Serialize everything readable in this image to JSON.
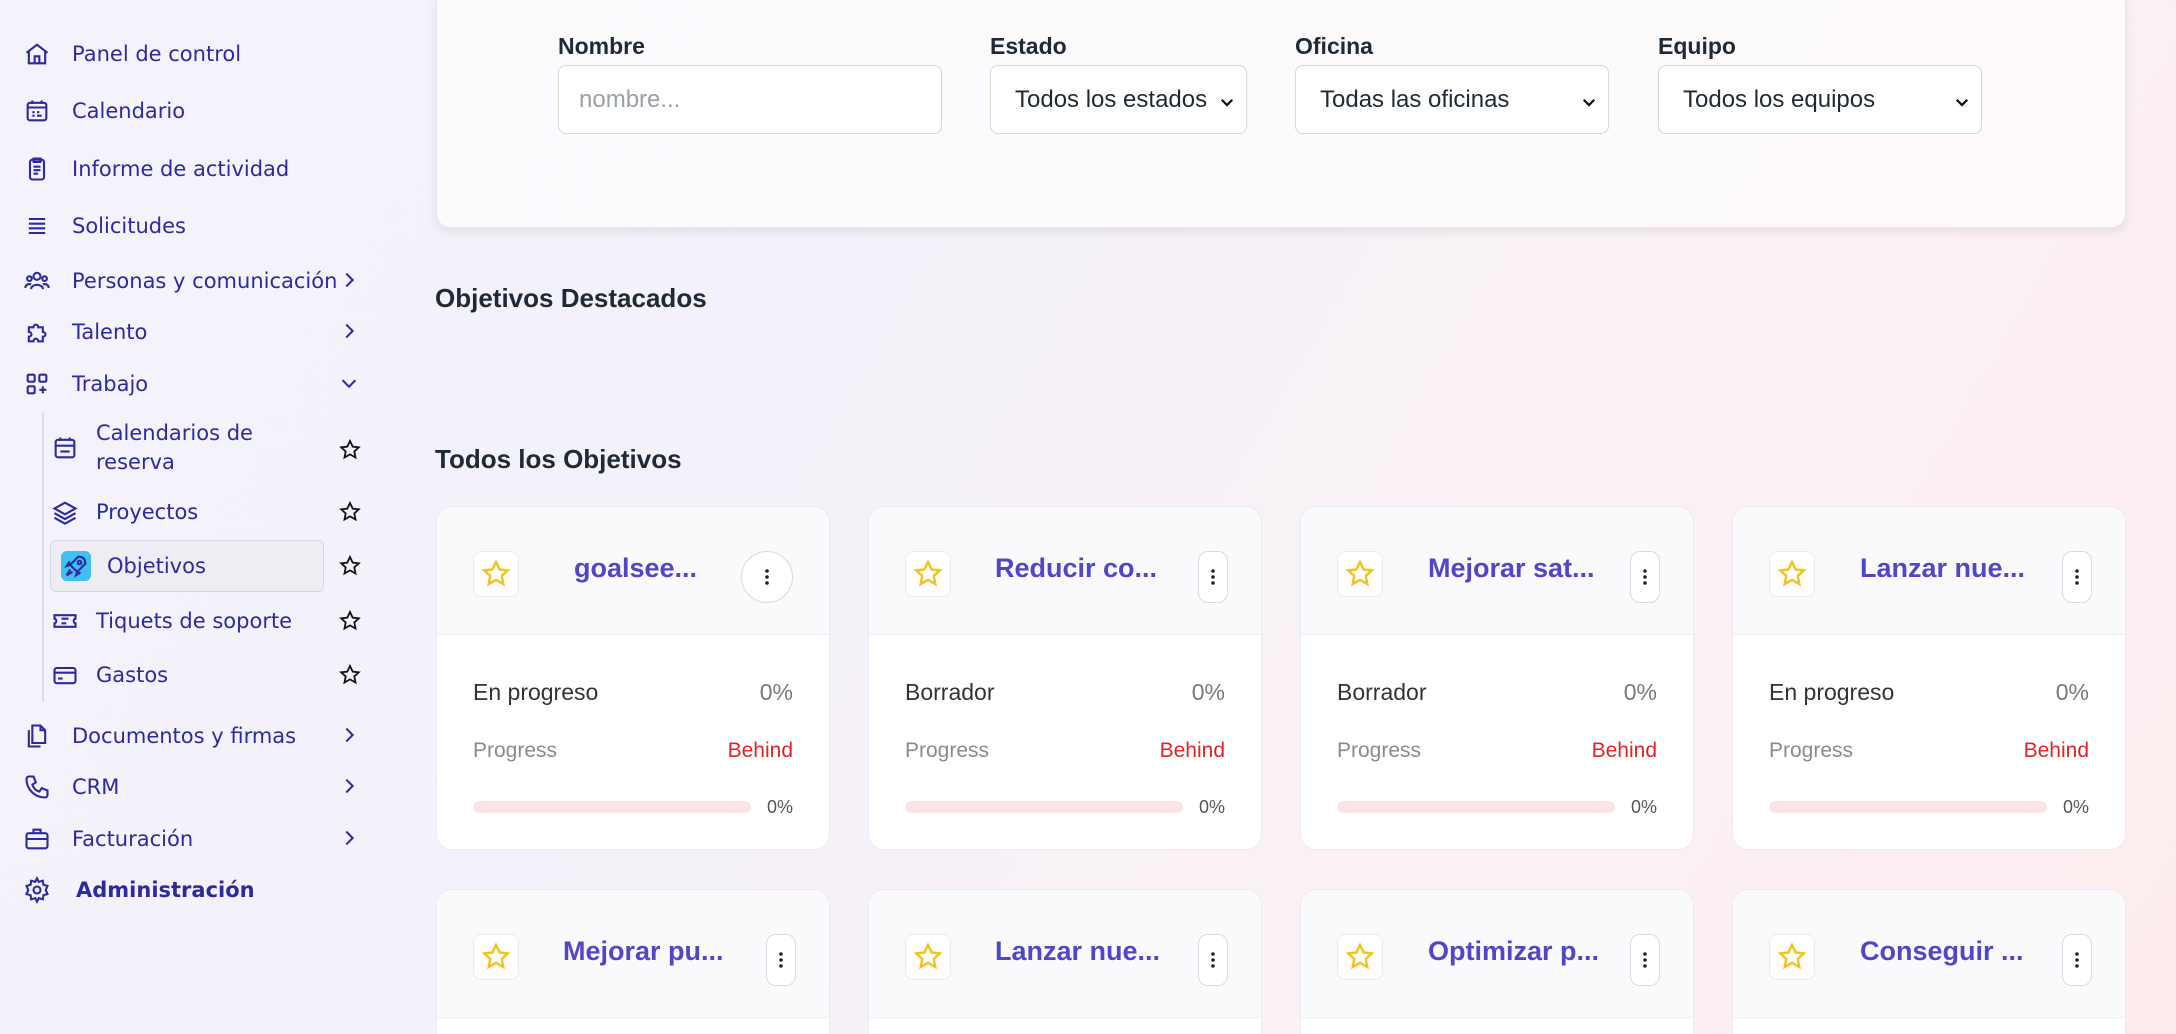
{
  "sidebar": {
    "items": [
      {
        "label": "Panel de control",
        "icon": "home-icon"
      },
      {
        "label": "Calendario",
        "icon": "calendar-icon"
      },
      {
        "label": "Informe de actividad",
        "icon": "clipboard-icon"
      },
      {
        "label": "Solicitudes",
        "icon": "list-icon"
      },
      {
        "label": "Personas y comunicación",
        "icon": "users-icon"
      },
      {
        "label": "Talento",
        "icon": "puzzle-icon"
      },
      {
        "label": "Trabajo",
        "icon": "grid-plus-icon"
      },
      {
        "label": "Documentos y firmas",
        "icon": "documents-icon"
      },
      {
        "label": "CRM",
        "icon": "phone-icon"
      },
      {
        "label": "Facturación",
        "icon": "briefcase-icon"
      },
      {
        "label": "Administración",
        "icon": "gear-icon"
      }
    ],
    "work_subitems": [
      {
        "label": "Calendarios de reserva",
        "icon": "calendar-booking-icon"
      },
      {
        "label": "Proyectos",
        "icon": "layers-icon"
      },
      {
        "label": "Objetivos",
        "icon": "rocket-icon"
      },
      {
        "label": "Tiquets de soporte",
        "icon": "ticket-icon"
      },
      {
        "label": "Gastos",
        "icon": "credit-card-icon"
      }
    ]
  },
  "filters": {
    "name_label": "Nombre",
    "name_placeholder": "nombre...",
    "status_label": "Estado",
    "status_value": "Todos los estados",
    "office_label": "Oficina",
    "office_value": "Todas las oficinas",
    "team_label": "Equipo",
    "team_value": "Todos los equipos"
  },
  "sections": {
    "featured": "Objetivos Destacados",
    "all": "Todos los Objetivos"
  },
  "cards": [
    {
      "title": "goalsee...",
      "status": "En progreso",
      "percent": "0%",
      "progress_label": "Progress",
      "progress_state": "Behind",
      "progress": 0,
      "progress_text": "0%"
    },
    {
      "title": "Reducir co...",
      "status": "Borrador",
      "percent": "0%",
      "progress_label": "Progress",
      "progress_state": "Behind",
      "progress": 0,
      "progress_text": "0%"
    },
    {
      "title": "Mejorar sat...",
      "status": "Borrador",
      "percent": "0%",
      "progress_label": "Progress",
      "progress_state": "Behind",
      "progress": 0,
      "progress_text": "0%"
    },
    {
      "title": "Lanzar nue...",
      "status": "En progreso",
      "percent": "0%",
      "progress_label": "Progress",
      "progress_state": "Behind",
      "progress": 0,
      "progress_text": "0%"
    },
    {
      "title": "Mejorar pu..."
    },
    {
      "title": "Lanzar nue..."
    },
    {
      "title": "Optimizar p..."
    },
    {
      "title": "Conseguir ..."
    }
  ],
  "colors": {
    "nav": "#2d2a9e",
    "card_title": "#4f46c8",
    "behind": "#dc2626",
    "star": "#f2c21b"
  }
}
